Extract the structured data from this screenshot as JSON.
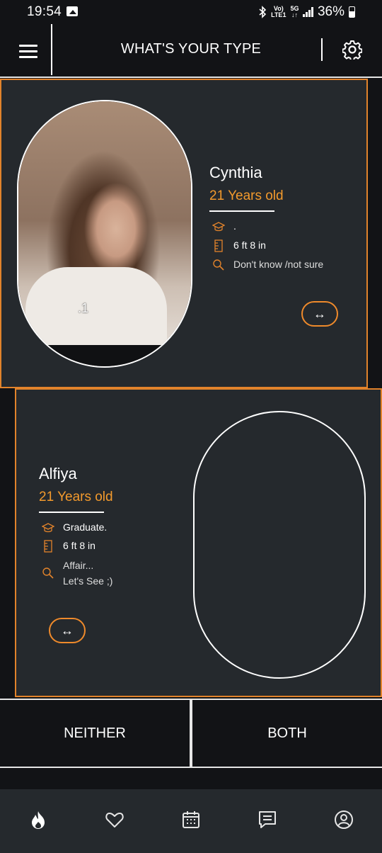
{
  "status_bar": {
    "time": "19:54",
    "network_top": "Vo)",
    "network_bottom": "LTE1",
    "fiveg_top": "5G",
    "fiveg_bottom": "↓↑",
    "battery": "36%"
  },
  "header": {
    "title": "WHAT'S YOUR TYPE",
    "menu_icon": "hamburger-menu-icon",
    "settings_icon": "gear-icon"
  },
  "profiles": [
    {
      "name": "Cynthia",
      "age": "21 Years old",
      "education": ".",
      "height": "6 ft 8 in",
      "looking_for": "Don't know /not sure",
      "photo_index": ".1",
      "swap_icon": "↔"
    },
    {
      "name": "Alfiya",
      "age": "21 Years old",
      "education": "Graduate.",
      "height": "6 ft 8 in",
      "looking_for_line1": "Affair...",
      "looking_for_line2": "Let's See ;)",
      "swap_icon": "↔"
    }
  ],
  "choices": {
    "neither": "NEITHER",
    "both": "BOTH"
  },
  "bottom_nav": [
    "flame-icon",
    "heart-icon",
    "calendar-icon",
    "chat-icon",
    "profile-icon"
  ],
  "colors": {
    "accent": "#f39a2d",
    "card_bg": "#25292d",
    "page_bg": "#121316"
  }
}
